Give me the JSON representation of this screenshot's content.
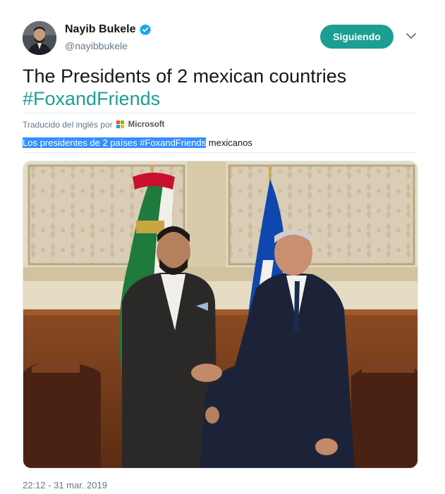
{
  "author": {
    "name": "Nayib Bukele",
    "handle": "@nayibbukele",
    "verified": true
  },
  "follow_button": {
    "label": "Siguiendo",
    "color": "#1b9f93"
  },
  "tweet": {
    "text_main": "The Presidents of 2 mexican countries",
    "hashtag": "#FoxandFriends"
  },
  "translation": {
    "credit_label": "Traducido del inglés por",
    "provider": "Microsoft",
    "highlighted_text": "Los presidentes de 2 países #FoxandFriends",
    "rest_text": " mexicanos"
  },
  "timestamp": "22:12 - 31 mar. 2019",
  "colors": {
    "accent": "#1b9f93",
    "verified_blue": "#1da1f2",
    "selection": "#3390ff"
  },
  "icons": {
    "verified": "verified-badge-icon",
    "caret": "chevron-down-icon",
    "logo": "microsoft-logo-icon"
  }
}
